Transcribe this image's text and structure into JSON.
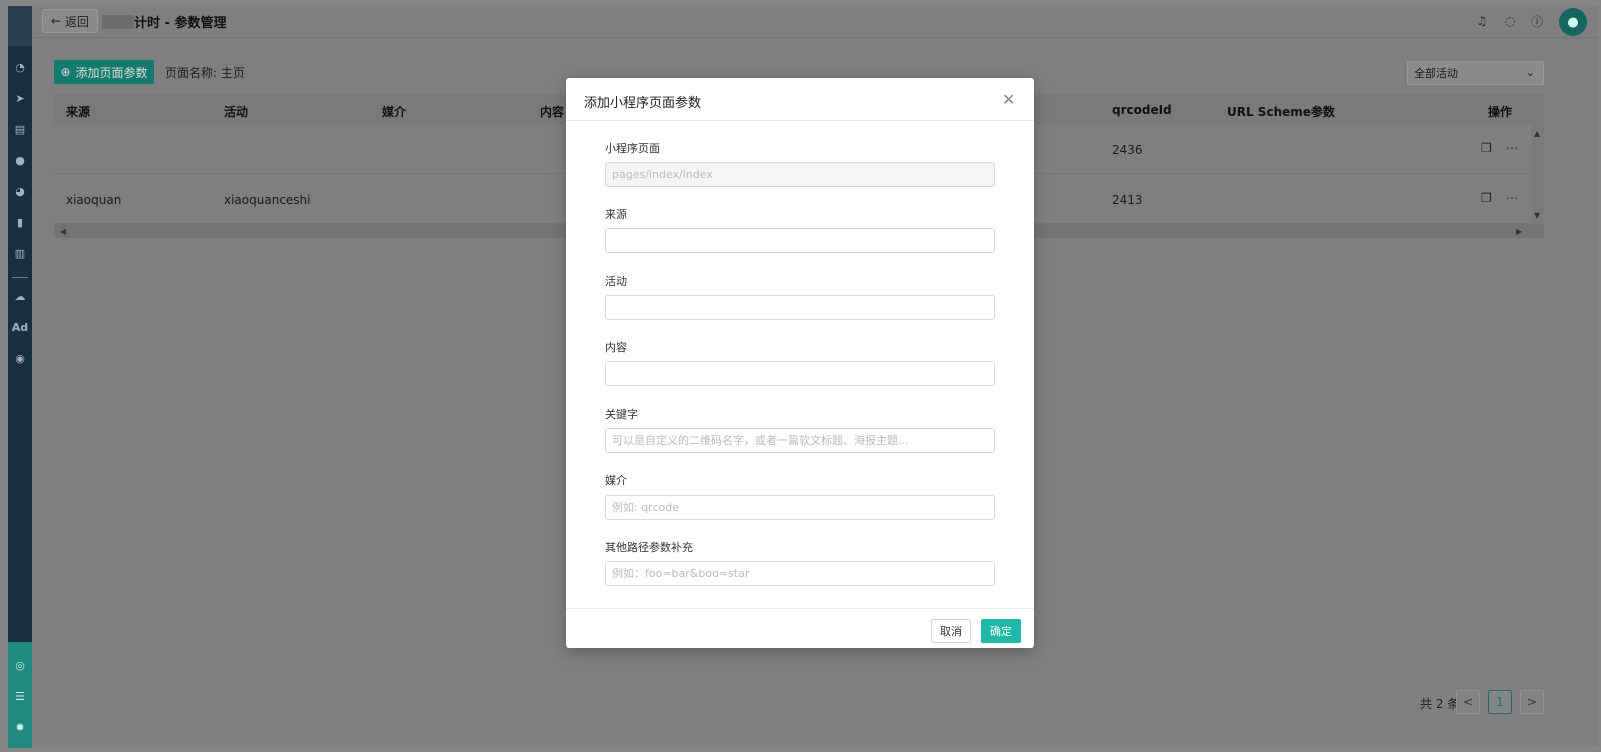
{
  "topbar": {
    "back_label": "返回",
    "title": "计时 - 参数管理",
    "icons": [
      "bell-icon",
      "chat-icon",
      "help-icon"
    ]
  },
  "toolbar": {
    "add_label": "添加页面参数",
    "page_name": "页面名称: 主页",
    "activity_select": "全部活动"
  },
  "table": {
    "headers": [
      "来源",
      "活动",
      "媒介",
      "内容",
      "qrcodeId",
      "URL Scheme参数",
      "操作"
    ],
    "rows": [
      {
        "source": "",
        "activity": "",
        "qrcode_id": "2436"
      },
      {
        "source": "xiaoquan",
        "activity": "xiaoquanceshi",
        "qrcode_id": "2413"
      }
    ]
  },
  "pagination": {
    "total": "共 2 条",
    "prev": "<",
    "current": "1",
    "next": ">"
  },
  "sidebar": {
    "icons": [
      "dashboard-icon",
      "send-icon",
      "layout-icon",
      "user-icon",
      "users-icon",
      "bookmark-icon",
      "bar-chart-icon",
      "wechat-icon",
      "ad-icon",
      "play-icon",
      "analytics-icon",
      "database-icon",
      "settings-icon"
    ],
    "ad_text": "Ad"
  },
  "modal": {
    "title": "添加小程序页面参数",
    "fields": [
      {
        "label": "小程序页面",
        "value": "",
        "placeholder": "pages/index/index"
      },
      {
        "label": "来源",
        "value": "",
        "placeholder": ""
      },
      {
        "label": "活动",
        "value": "",
        "placeholder": ""
      },
      {
        "label": "内容",
        "value": "",
        "placeholder": ""
      },
      {
        "label": "关键字",
        "value": "",
        "placeholder": "可以是自定义的二维码名字，或者一篇软文标题、海报主题..."
      },
      {
        "label": "媒介",
        "value": "",
        "placeholder": "例如: qrcode"
      },
      {
        "label": "其他路径参数补充",
        "value": "",
        "placeholder": "例如：foo=bar&boo=star"
      }
    ],
    "cancel_label": "取消",
    "ok_label": "确定"
  },
  "colors": {
    "accent": "#1db8a6",
    "sidebar": "#1b2f44"
  }
}
